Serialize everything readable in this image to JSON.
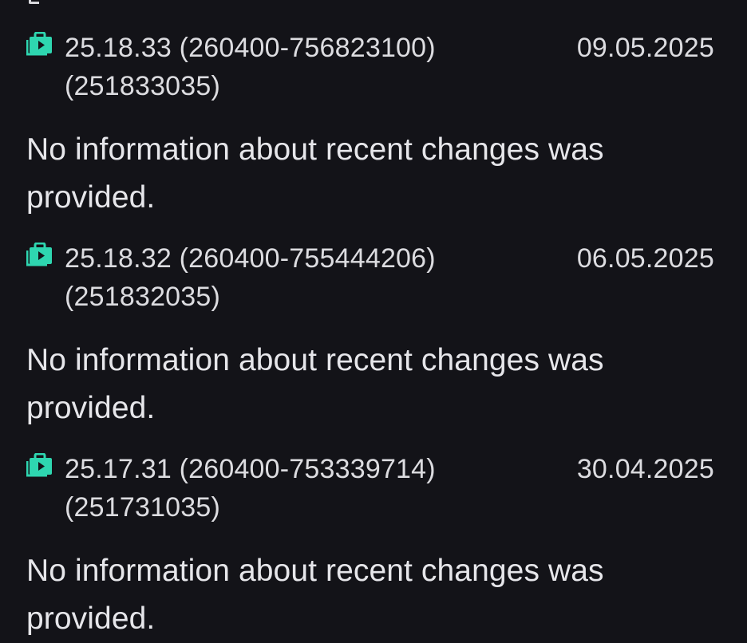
{
  "versions": [
    {
      "version": "25.18.33 (260400-756823100)",
      "code": "(251833035)",
      "date": "09.05.2025",
      "notes": "No information about recent changes was provided."
    },
    {
      "version": "25.18.32 (260400-755444206)",
      "code": "(251832035)",
      "date": "06.05.2025",
      "notes": "No information about recent changes was provided."
    },
    {
      "version": "25.17.31 (260400-753339714)",
      "code": "(251731035)",
      "date": "30.04.2025",
      "notes": "No information about recent changes was provided."
    }
  ],
  "icon": "package-icon",
  "accent_color": "#2ed6b0"
}
